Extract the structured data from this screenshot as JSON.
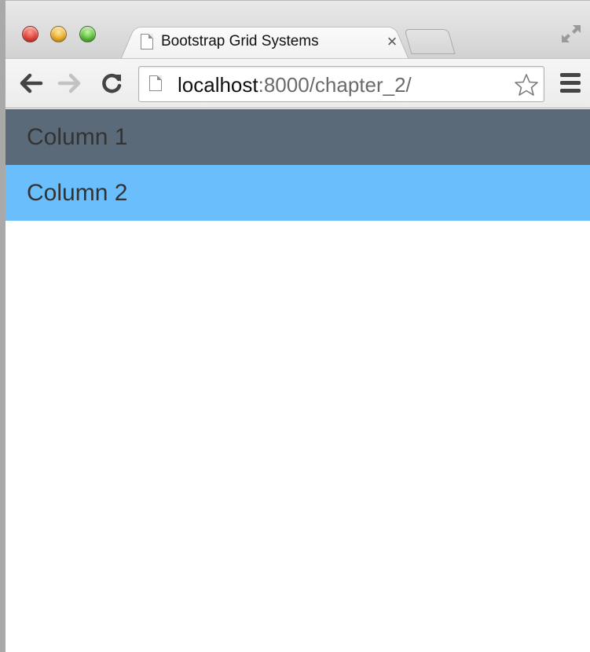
{
  "browser": {
    "tab": {
      "title": "Bootstrap Grid Systems",
      "close_symbol": "×"
    },
    "address_bar": {
      "host": "localhost",
      "path": ":8000/chapter_2/"
    },
    "icons": {
      "back": "back-arrow-icon",
      "forward": "forward-arrow-icon",
      "reload": "reload-icon",
      "bookmark": "star-icon",
      "menu": "hamburger-menu-icon",
      "page": "page-icon",
      "fullscreen": "fullscreen-icon"
    },
    "colors": {
      "close": "#e0443a",
      "minimize": "#e9ad2c",
      "zoom": "#5cbf3c"
    }
  },
  "page": {
    "columns": [
      {
        "label": "Column 1",
        "background": "#5b6a78"
      },
      {
        "label": "Column 2",
        "background": "#6abefc"
      }
    ]
  }
}
